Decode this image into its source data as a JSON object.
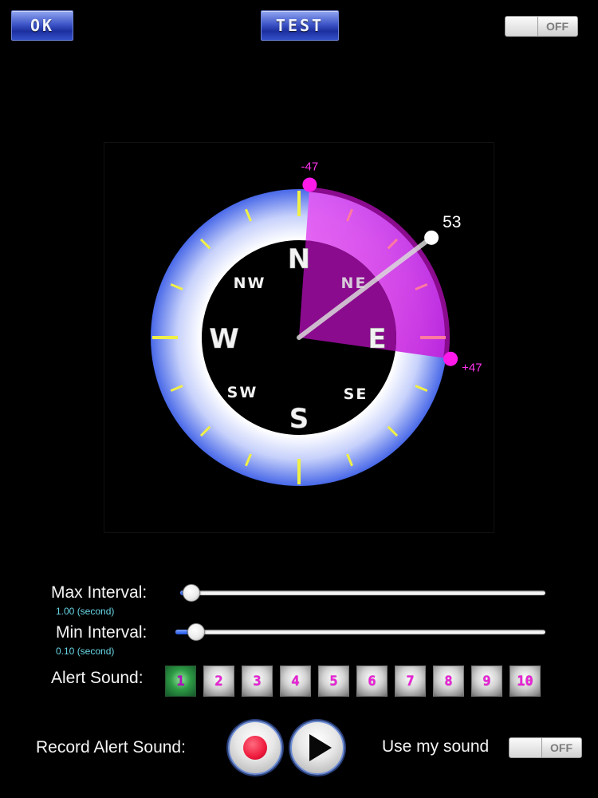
{
  "header": {
    "ok_label": "OK",
    "test_label": "TEST",
    "toggle_label": "OFF"
  },
  "compass": {
    "directions": {
      "n": "N",
      "ne": "NE",
      "e": "E",
      "se": "SE",
      "s": "S",
      "sw": "SW",
      "w": "W",
      "nw": "NW"
    },
    "heading_deg": 53,
    "heading_label": "53",
    "range_min_deg": -47,
    "range_max_deg": 47,
    "range_min_label": "-47",
    "range_max_label": "+47",
    "colors": {
      "ring_outer": "#4868e8",
      "ring_inner": "#ffffff",
      "tick": "#f0f046",
      "sector": "#dd33ee",
      "sector_dark": "#8a0b8e",
      "range_dot": "#ff1aea",
      "needle": "#d9d9d9"
    }
  },
  "settings": {
    "max_interval": {
      "label": "Max Interval:",
      "value_text": "1.00 (second)",
      "fraction": 0.0
    },
    "min_interval": {
      "label": "Min Interval:",
      "value_text": "0.10 (second)",
      "fraction": 0.03
    },
    "alert_sound": {
      "label": "Alert Sound:",
      "options": [
        "1",
        "2",
        "3",
        "4",
        "5",
        "6",
        "7",
        "8",
        "9",
        "10"
      ],
      "selected": "1"
    },
    "record": {
      "label": "Record Alert Sound:",
      "use_my_sound_label": "Use my sound",
      "use_my_sound_toggle": "OFF"
    }
  }
}
